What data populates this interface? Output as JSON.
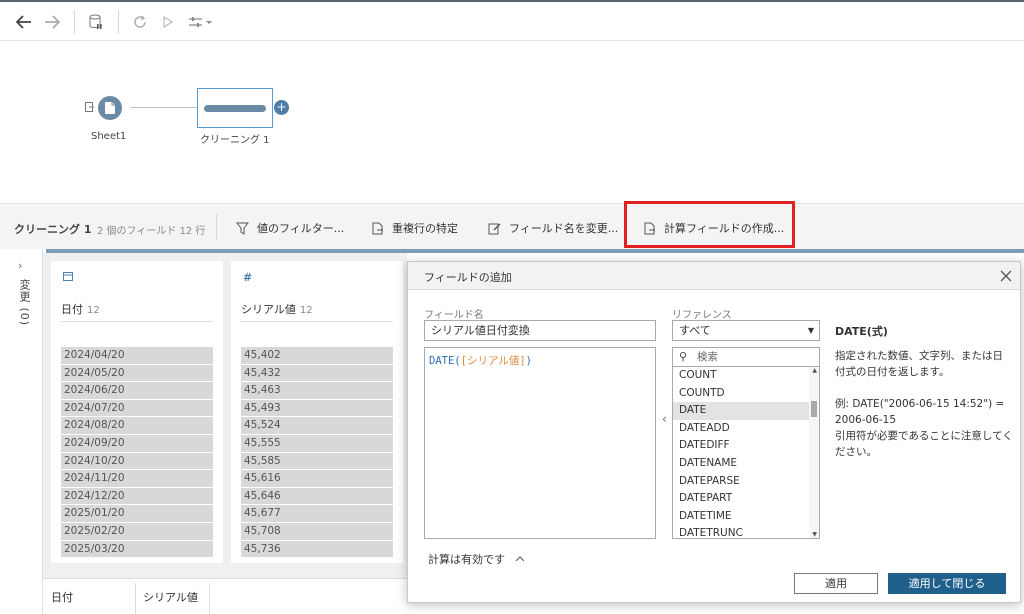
{
  "flow": {
    "input_node_label": "Sheet1",
    "clean_node_label": "クリーニング 1"
  },
  "stepbar": {
    "title": "クリーニング 1",
    "meta": "2 個のフィールド  12 行",
    "actions": {
      "filter": "値のフィルター...",
      "duplicates": "重複行の特定",
      "rename": "フィールド名を変更...",
      "calc": "計算フィールドの作成..."
    }
  },
  "changes": {
    "label": "変更 (0)"
  },
  "profile": {
    "date_card": {
      "name": "日付",
      "count": "12",
      "values": [
        "2024/04/20",
        "2024/05/20",
        "2024/06/20",
        "2024/07/20",
        "2024/08/20",
        "2024/09/20",
        "2024/10/20",
        "2024/11/20",
        "2024/12/20",
        "2025/01/20",
        "2025/02/20",
        "2025/03/20"
      ]
    },
    "serial_card": {
      "name": "シリアル値",
      "count": "12",
      "values": [
        "45,402",
        "45,432",
        "45,463",
        "45,493",
        "45,524",
        "45,555",
        "45,585",
        "45,616",
        "45,646",
        "45,677",
        "45,708",
        "45,736"
      ]
    }
  },
  "bottom_table": {
    "col1": "日付",
    "col2": "シリアル値"
  },
  "dialog": {
    "title": "フィールドの追加",
    "field_name_label": "フィールド名",
    "field_name_value": "シリアル値日付変換",
    "formula_fn": "DATE",
    "formula_open": "(",
    "formula_field": "[シリアル値]",
    "formula_close": ")",
    "valid_text": "計算は有効です",
    "reference_label": "リファレンス",
    "reference_select": "すべて",
    "search_placeholder": "検索",
    "functions": [
      "COUNT",
      "COUNTD",
      "DATE",
      "DATEADD",
      "DATEDIFF",
      "DATENAME",
      "DATEPARSE",
      "DATEPART",
      "DATETIME",
      "DATETRUNC"
    ],
    "selected_function": "DATE",
    "doc_title": "DATE(式)",
    "doc_desc": "指定された数値、文字列、または日付式の日付を返します。",
    "doc_example": "例: DATE(\"2006-06-15 14:52\") = 2006-06-15",
    "doc_note": "引用符が必要であることに注意してください。",
    "apply_label": "適用",
    "apply_close_label": "適用して閉じる"
  }
}
